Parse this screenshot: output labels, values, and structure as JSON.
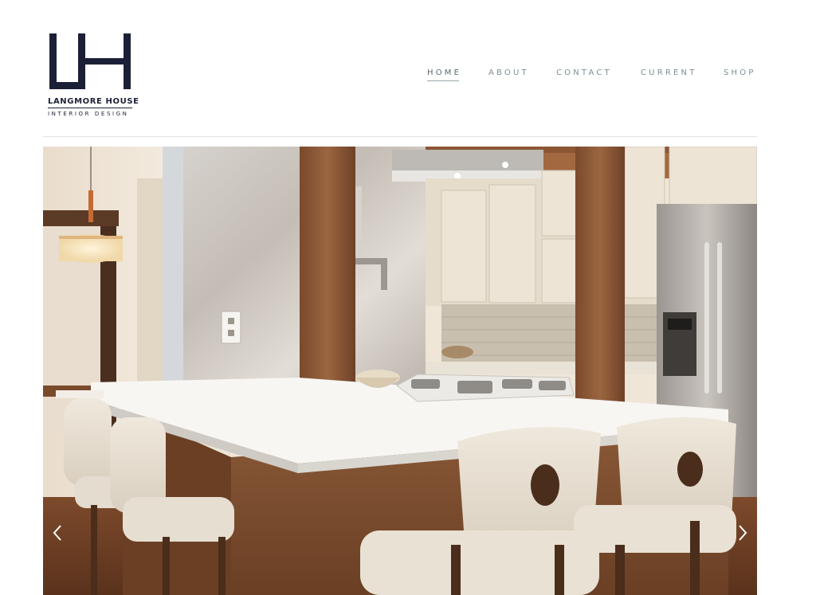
{
  "brand": {
    "monogram": "LH",
    "name": "LANGMORE HOUSE",
    "tagline": "INTERIOR DESIGN",
    "color": "#1c2036"
  },
  "nav": {
    "items": [
      {
        "label": "HOME",
        "active": true
      },
      {
        "label": "ABOUT",
        "active": false
      },
      {
        "label": "CONTACT",
        "active": false
      },
      {
        "label": "CURRENT",
        "active": false
      },
      {
        "label": "SHOP",
        "active": false
      }
    ],
    "color": "#7d8f96"
  },
  "slider": {
    "image_subject": "kitchen-island-photo",
    "prev_icon": "chevron-left-icon",
    "next_icon": "chevron-right-icon"
  }
}
